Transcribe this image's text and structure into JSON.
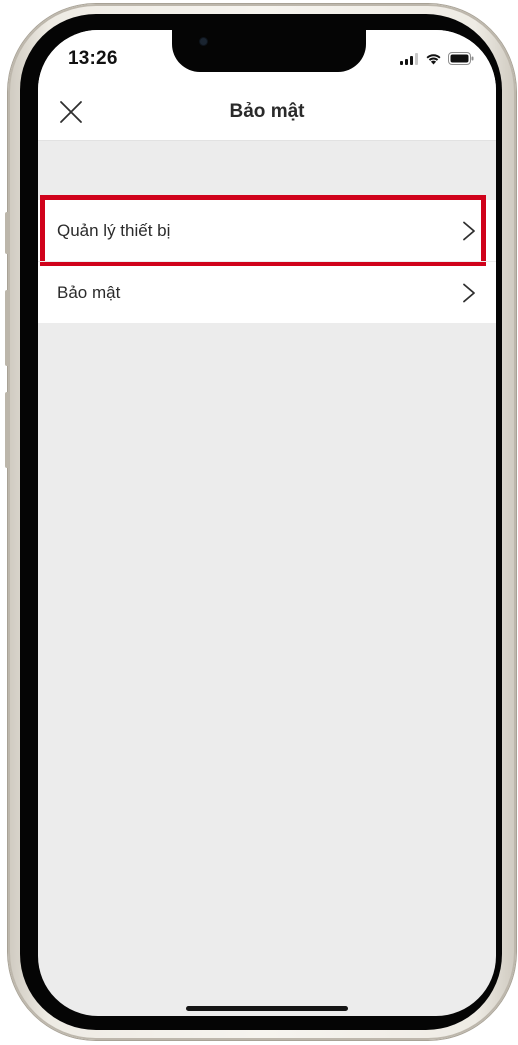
{
  "status_bar": {
    "time": "13:26",
    "icons": [
      "cellular-signal-icon",
      "wifi-icon",
      "battery-icon"
    ]
  },
  "header": {
    "title": "Bảo mật",
    "close_icon": "close-icon"
  },
  "settings": {
    "items": [
      {
        "label": "Quản lý thiết bị",
        "icon": "chevron-right-icon",
        "highlighted": true
      },
      {
        "label": "Bảo mật",
        "icon": "chevron-right-icon",
        "highlighted": false
      }
    ]
  },
  "colors": {
    "highlight": "#d0021b",
    "background": "#ececec",
    "surface": "#ffffff",
    "text": "#2b2b2b"
  }
}
